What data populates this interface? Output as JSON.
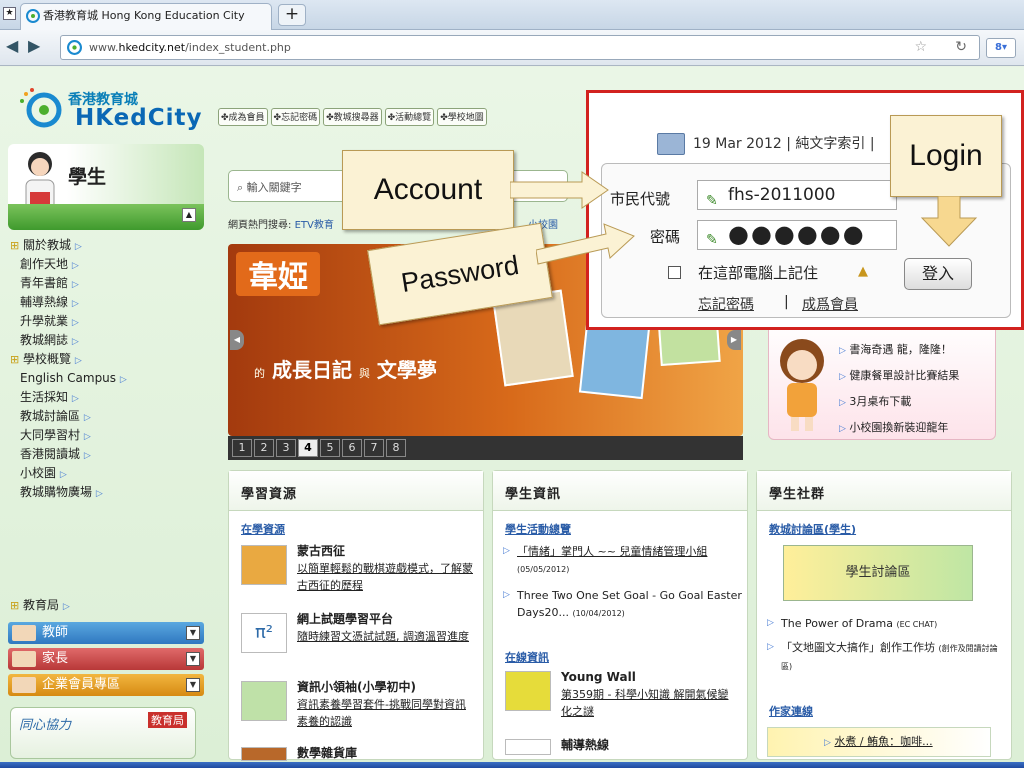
{
  "browser": {
    "tab_title": "香港教育城 Hong Kong Education City",
    "new_tab": "+",
    "url_prefix": "www.",
    "url_domain": "hkedcity.net",
    "url_path": "/index_student.php"
  },
  "header": {
    "logo_zh": "香港教育城",
    "logo_hk": "HK",
    "logo_edcity": "edCity",
    "toplinks": [
      "✤成為會員",
      "✤忘記密碼",
      "✤教城搜尋器",
      "✤活動總覽",
      "✤學校地圖"
    ]
  },
  "sidebar": {
    "title": "學生",
    "items": [
      {
        "label": "關於教城",
        "sq": true
      },
      {
        "label": "創作天地"
      },
      {
        "label": "青年書館"
      },
      {
        "label": "輔導熱線"
      },
      {
        "label": "升學就業"
      },
      {
        "label": "教城網誌"
      },
      {
        "label": "學校概覽",
        "sq": true
      },
      {
        "label": "English Campus"
      },
      {
        "label": "生活採知"
      },
      {
        "label": "教城討論區"
      },
      {
        "label": "大同學習村"
      },
      {
        "label": "香港閱讀城"
      },
      {
        "label": "小校園"
      },
      {
        "label": "教城購物廣場"
      }
    ],
    "edb": "教育局",
    "roles": [
      "教師",
      "家長",
      "企業會員專區"
    ],
    "promo_1": "同心協力",
    "promo_2": "教育局"
  },
  "search": {
    "placeholder": "輸入關鍵字",
    "hot_label": "網頁熱門搜尋:",
    "hot_1": "ETV教育",
    "hot_2": "小校園"
  },
  "banner": {
    "title": "韋婭",
    "sub_a": "的",
    "sub_b": "成長日記",
    "sub_c": "與",
    "sub_d": "文學夢",
    "pages": [
      "1",
      "2",
      "3",
      "4",
      "5",
      "6",
      "7",
      "8"
    ],
    "current_page": "4"
  },
  "panels": {
    "learning": {
      "title": "學習資源",
      "section": "在學資源",
      "items": [
        {
          "title": "蒙古西征",
          "desc": "以簡單輕鬆的戰棋遊戲模式，了解蒙古西征的歷程"
        },
        {
          "title": "網上試題學習平台",
          "desc": "隨時練習文憑試試題, 調適溫習進度"
        },
        {
          "title": "資訊小領袖(小學初中)",
          "desc": "資訊素養學習套件-挑戰同學對資訊素養的認識"
        },
        {
          "title": "數學雜貨庫",
          "desc": ""
        }
      ]
    },
    "news": {
      "title": "學生資訊",
      "section1": "學生活動總覽",
      "links": [
        {
          "text": "「情緒」掌門人 ~~ 兒童情緒管理小組",
          "date": "(05/05/2012)"
        },
        {
          "text": "Three Two One Set Goal - Go Goal Easter Days20...",
          "date": "(10/04/2012)"
        }
      ],
      "section2": "在線資訊",
      "items": [
        {
          "title": "Young Wall",
          "desc": "第359期 - 科學小知識 解開氣候變化之謎"
        },
        {
          "title": "輔導熱線",
          "desc": ""
        }
      ]
    },
    "community": {
      "title": "學生社群",
      "section1": "教城討論區(學生)",
      "forum_banner": "學生討論區",
      "links": [
        {
          "text": "The Power of Drama",
          "tag": "(EC CHAT)"
        },
        {
          "text": "「文地圖文大搞作」創作工作坊",
          "tag": "(創作及閱讀討論區)"
        }
      ],
      "section2": "作家連線",
      "writer": "水煮 / 鮪魚：咖啡..."
    }
  },
  "notice": {
    "items": [
      "書海奇遇 龍，隆隆！",
      "健康餐單設計比賽結果",
      "3月桌布下載",
      "小校園換新裝迎龍年"
    ]
  },
  "login": {
    "date": "19 Mar 2012",
    "text_index": "純文字索引",
    "id_label": "市民代號",
    "id_value": "fhs-2011000",
    "pw_label": "密碼",
    "pw_value": "●●●●●●",
    "remember": "在這部電腦上記住",
    "submit": "登入",
    "forgot": "忘記密碼",
    "register": "成爲會員"
  },
  "callouts": {
    "account": "Account",
    "password": "Password",
    "login": "Login"
  }
}
